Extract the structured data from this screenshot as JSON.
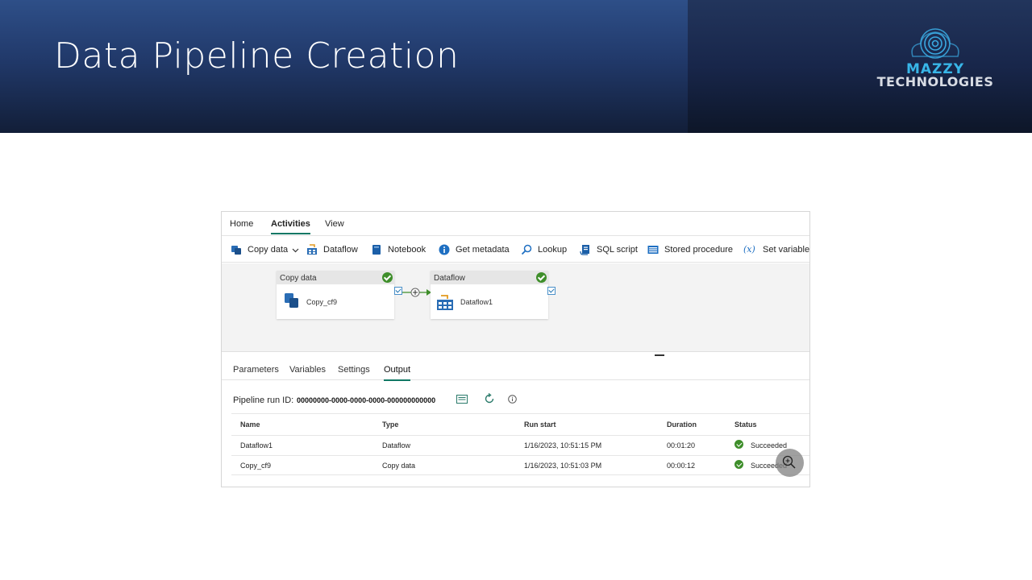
{
  "slide": {
    "title": "Data Pipeline Creation",
    "logo": {
      "line1": "MAZZY",
      "line2": "TECHNOLOGIES"
    }
  },
  "menu": {
    "tabs": [
      {
        "label": "Home",
        "active": false
      },
      {
        "label": "Activities",
        "active": true
      },
      {
        "label": "View",
        "active": false
      }
    ]
  },
  "toolbar": {
    "items": [
      {
        "label": "Copy data",
        "icon": "copy-data-icon"
      },
      {
        "label": "Dataflow",
        "icon": "dataflow-icon"
      },
      {
        "label": "Notebook",
        "icon": "notebook-icon"
      },
      {
        "label": "Get metadata",
        "icon": "info-icon"
      },
      {
        "label": "Lookup",
        "icon": "lookup-icon"
      },
      {
        "label": "SQL script",
        "icon": "sql-script-icon"
      },
      {
        "label": "Stored procedure",
        "icon": "stored-procedure-icon"
      },
      {
        "label": "Set variable",
        "icon": "variable-icon",
        "glyph": "(x)"
      }
    ]
  },
  "canvas": {
    "activities": [
      {
        "type_label": "Copy data",
        "name": "Copy_cf9",
        "status": "succeeded"
      },
      {
        "type_label": "Dataflow",
        "name": "Dataflow1",
        "status": "succeeded"
      }
    ]
  },
  "output_tabs": [
    {
      "label": "Parameters",
      "active": false
    },
    {
      "label": "Variables",
      "active": false
    },
    {
      "label": "Settings",
      "active": false
    },
    {
      "label": "Output",
      "active": true
    }
  ],
  "output": {
    "run_id_label": "Pipeline run ID:",
    "run_id": "00000000-0000-0000-0000-000000000000",
    "columns": [
      "Name",
      "Type",
      "Run start",
      "Duration",
      "Status"
    ],
    "rows": [
      [
        "Dataflow1",
        "Dataflow",
        "1/16/2023, 10:51:15 PM",
        "00:01:20",
        "Succeeded"
      ],
      [
        "Copy_cf9",
        "Copy data",
        "1/16/2023, 10:51:03 PM",
        "00:00:12",
        "Succeeded"
      ]
    ]
  },
  "colors": {
    "accent": "#117865",
    "success": "#3e8e2a",
    "header_blue": "#2e4f88"
  }
}
